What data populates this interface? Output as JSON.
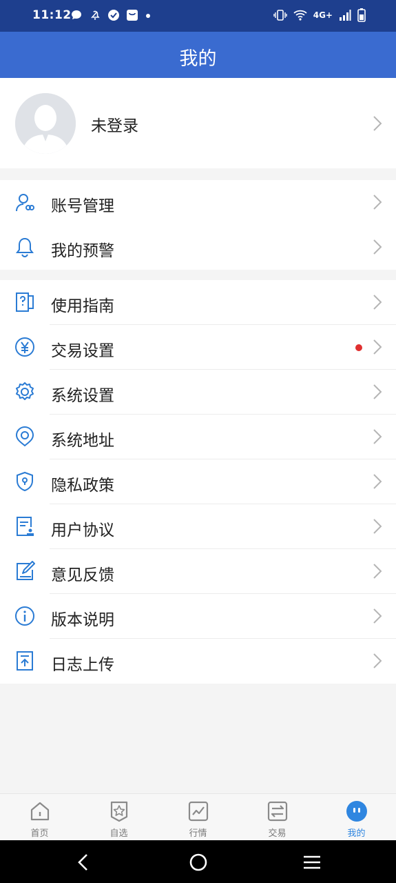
{
  "status_bar": {
    "time": "11:12",
    "network": "4G+",
    "icons_left": [
      "message-icon",
      "mute-icon",
      "check-icon",
      "shopping-icon",
      "dot-icon"
    ],
    "icons_right": [
      "vibrate-icon",
      "wifi-icon",
      "signal-icon",
      "battery-icon"
    ]
  },
  "header": {
    "title": "我的"
  },
  "profile": {
    "name": "未登录"
  },
  "group1": [
    {
      "label": "账号管理",
      "icon": "account-icon"
    },
    {
      "label": "我的预警",
      "icon": "bell-icon"
    }
  ],
  "group2": [
    {
      "label": "使用指南",
      "icon": "guide-icon"
    },
    {
      "label": "交易设置",
      "icon": "yuan-icon",
      "badge": "red-dot"
    },
    {
      "label": "系统设置",
      "icon": "gear-icon"
    },
    {
      "label": "系统地址",
      "icon": "location-icon"
    },
    {
      "label": "隐私政策",
      "icon": "shield-lock-icon"
    },
    {
      "label": "用户协议",
      "icon": "agreement-icon"
    },
    {
      "label": "意见反馈",
      "icon": "edit-icon"
    },
    {
      "label": "版本说明",
      "icon": "info-icon"
    },
    {
      "label": "日志上传",
      "icon": "upload-icon"
    }
  ],
  "tabs": [
    {
      "label": "首页",
      "icon": "home-icon"
    },
    {
      "label": "自选",
      "icon": "star-icon"
    },
    {
      "label": "行情",
      "icon": "chart-icon"
    },
    {
      "label": "交易",
      "icon": "exchange-icon"
    },
    {
      "label": "我的",
      "icon": "me-icon",
      "active": true
    }
  ],
  "colors": {
    "status_bar": "#1e3f8e",
    "header": "#3a6bd0",
    "accent": "#2f86e0",
    "icon_blue": "#2a7bd4",
    "badge_red": "#e03030"
  }
}
